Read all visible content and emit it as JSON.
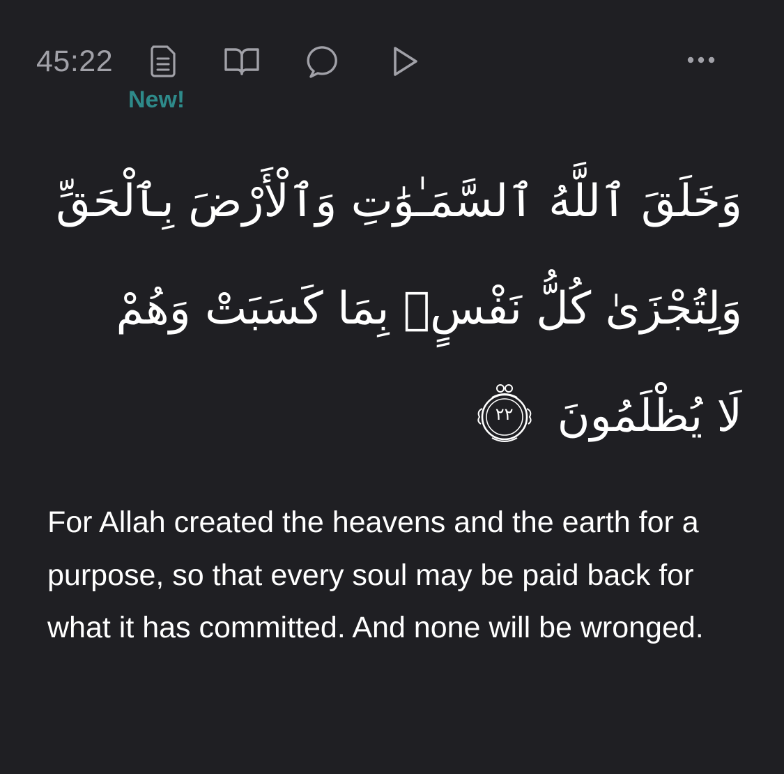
{
  "toolbar": {
    "verse_key": "45:22",
    "new_badge": "New!",
    "icons": {
      "tafsir": "tafsir-document-icon",
      "reading": "open-book-icon",
      "reflect": "speech-bubble-icon",
      "play": "play-icon",
      "more": "more-dots-icon"
    }
  },
  "verse": {
    "arabic_lines": [
      "وَخَلَقَ ٱللَّهُ ٱلسَّمَـٰوَٰتِ وَٱلْأَرْضَ بِٱلْحَقِّ",
      "وَلِتُجْزَىٰ كُلُّ نَفْسٍۭ بِمَا كَسَبَتْ وَهُمْ",
      "لَا يُظْلَمُونَ"
    ],
    "ayah_number": "٢٢",
    "translation": "For Allah created the heavens and the earth for a purpose, so that every soul may be paid back for what it has committed. And none will be wronged."
  },
  "colors": {
    "background": "#1f1f23",
    "icon_gray": "#a1a1a8",
    "accent_teal": "#2e8a8a",
    "text_white": "#ffffff"
  }
}
